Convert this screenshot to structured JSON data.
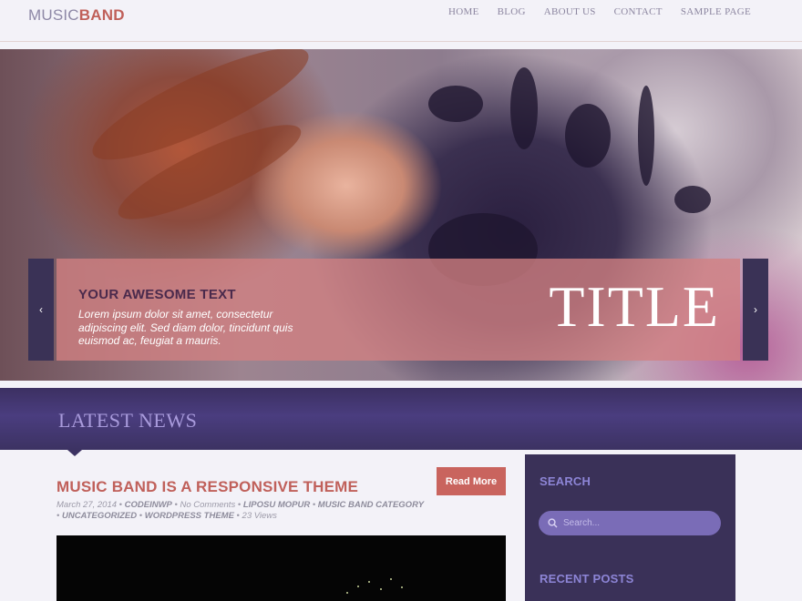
{
  "header": {
    "logo_part1": "MUSIC",
    "logo_part2": "BAND",
    "nav": [
      "HOME",
      "BLOG",
      "ABOUT US",
      "CONTACT",
      "SAMPLE PAGE"
    ]
  },
  "slider": {
    "heading": "YOUR AWESOME TEXT",
    "text": "Lorem ipsum dolor sit amet, consectetur adipiscing elit. Sed diam dolor, tincidunt quis euismod ac, feugiat a mauris.",
    "title": "TITLE",
    "prev": "‹",
    "next": "›"
  },
  "news": {
    "heading": "LATEST NEWS"
  },
  "post": {
    "title": "MUSIC BAND IS A RESPONSIVE THEME",
    "read_more": "Read More",
    "date": "March 27, 2014",
    "author": "CODEINWP",
    "comments": "No Comments",
    "categories": [
      "LIPOSU MOPUR",
      "MUSIC BAND CATEGORY",
      "UNCATEGORIZED",
      "WORDPRESS THEME"
    ],
    "views": "23 Views"
  },
  "sidebar": {
    "search_heading": "SEARCH",
    "search_placeholder": "Search...",
    "recent_heading": "RECENT POSTS"
  },
  "colors": {
    "accent": "#c0605a",
    "purple_dark": "#3a3158",
    "purple_light": "#8d85d6",
    "background": "#f3f2f8"
  }
}
